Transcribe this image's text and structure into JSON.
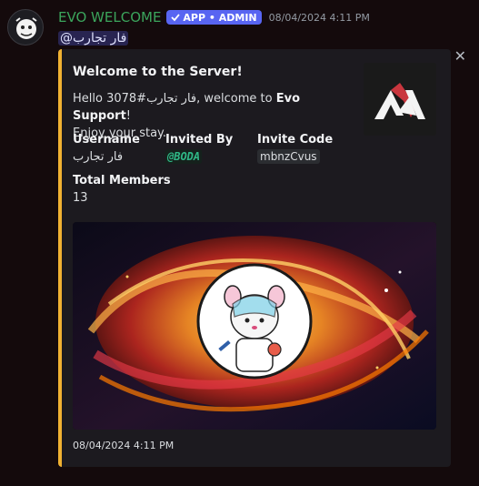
{
  "message": {
    "author": "EVO WELCOME",
    "badge": "APP • ADMIN",
    "timestamp": "08/04/2024 4:11 PM",
    "mention": "@فار تجارب"
  },
  "embed": {
    "title": "Welcome to the Server!",
    "desc_hello": "Hello 3078#فار تجارب, welcome to ",
    "desc_server": "Evo Support",
    "desc_tail": "!",
    "desc_line2": "Enjoy your stay.",
    "fields": {
      "username_label": "Username",
      "username_value": "فار تجارب",
      "invited_label": "Invited By",
      "invited_value": "@BODA",
      "invite_code_label": "Invite Code",
      "invite_code_value": "mbnzCvus",
      "members_label": "Total Members",
      "members_value": "13"
    },
    "footer": "08/04/2024 4:11 PM",
    "accent_color": "#f0b132"
  },
  "icons": {
    "close": "close-icon",
    "badge_check": "check-icon"
  }
}
